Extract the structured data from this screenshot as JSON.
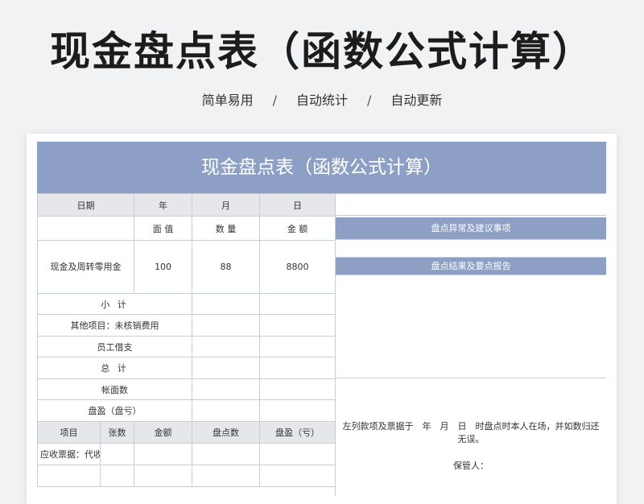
{
  "hero": {
    "title": "现金盘点表（函数公式计算）",
    "subtitle_items": [
      "简单易用",
      "自动统计",
      "自动更新"
    ],
    "separator": "/"
  },
  "sheet": {
    "banner_title": "现金盘点表（函数公式计算）",
    "date_row": {
      "date": "日期",
      "year": "年",
      "month": "月",
      "day": "日"
    },
    "header_row": {
      "face_value": "面 值",
      "quantity": "数 量",
      "amount": "金 额"
    },
    "cash_row": {
      "label": "现金及周转零用金",
      "face_value": "100",
      "quantity": "88",
      "amount": "8800"
    },
    "subtotal": "小 计",
    "other_items": "其他项目：未核销费用",
    "employee_loan": "员工借支",
    "total": "总 计",
    "book_value": "帐面数",
    "surplus": "盘盈（盘亏）",
    "lower_header": {
      "item": "项目",
      "sheets": "张数",
      "amount": "金额",
      "count": "盘点数",
      "surplus": "盘盈（亏）"
    },
    "receivable_row": {
      "item": "应收票据：代收"
    },
    "right_panel": {
      "anomaly_header": "盘点异常及建议事项",
      "result_header": "盘点结果及要点报告",
      "statement": "左列款项及票据于　年　月　日　时盘点时本人在场，并如数归还无误。",
      "custodian": "保管人："
    }
  },
  "colors": {
    "header_blue": "#8e9fc6",
    "label_gray": "#e5e7eb",
    "border": "#c9ced6"
  }
}
